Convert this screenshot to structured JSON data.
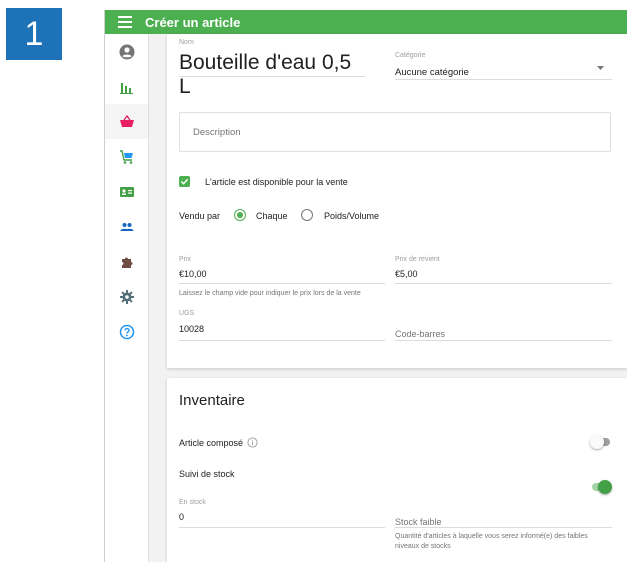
{
  "step_number": "1",
  "header": {
    "title": "Créer un article"
  },
  "colors": {
    "accent": "#4caf50",
    "step_badge": "#1e73b8",
    "active_nav": "#e91e63",
    "nav_icon": "#43a047",
    "help_icon": "#2196f3"
  },
  "sidebar": {
    "items": [
      {
        "icon": "account-icon"
      },
      {
        "icon": "bar-chart-icon"
      },
      {
        "icon": "basket-icon",
        "active": true
      },
      {
        "icon": "cart-icon"
      },
      {
        "icon": "id-card-icon"
      },
      {
        "icon": "people-icon"
      },
      {
        "icon": "puzzle-icon"
      },
      {
        "icon": "settings-icon"
      },
      {
        "icon": "help-icon"
      }
    ]
  },
  "form": {
    "name_label": "Nom",
    "name_value": "Bouteille d'eau 0,5 L",
    "category_label": "Catégorie",
    "category_value": "Aucune catégorie",
    "description_placeholder": "Description",
    "available_label": "L'article est disponible pour la vente",
    "sold_by_label": "Vendu par",
    "sold_by_options": [
      "Chaque",
      "Poids/Volume"
    ],
    "sold_by_selected": "Chaque",
    "price_label": "Prix",
    "price_value": "€10,00",
    "price_hint": "Laissez le champ vide pour indiquer le prix lors de la vente",
    "cost_label": "Prix de revient",
    "cost_value": "€5,00",
    "sku_label": "UGS",
    "sku_value": "10028",
    "barcode_placeholder": "Code-barres"
  },
  "inventory": {
    "title": "Inventaire",
    "composite_label": "Article composé",
    "composite_on": false,
    "track_stock_label": "Suivi de stock",
    "track_stock_on": true,
    "in_stock_label": "En stock",
    "in_stock_value": "0",
    "low_stock_placeholder": "Stock faible",
    "low_stock_hint": "Quantité d'articles à laquelle vous serez informé(e) des faibles niveaux de stocks"
  }
}
